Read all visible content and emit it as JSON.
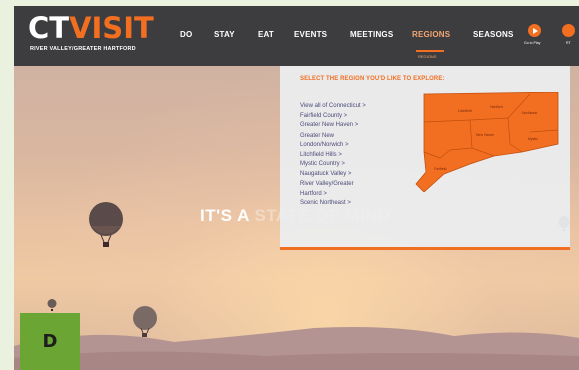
{
  "logo": {
    "part1": "CT",
    "part2": "VISIT",
    "subtitle": "RIVER VALLEY/GREATER HARTFORD"
  },
  "nav": {
    "items": [
      {
        "label": "DO"
      },
      {
        "label": "STAY"
      },
      {
        "label": "EAT"
      },
      {
        "label": "EVENTS"
      },
      {
        "label": "MEETINGS"
      },
      {
        "label": "REGIONS"
      },
      {
        "label": "SEASONS"
      }
    ],
    "active": "REGIONS",
    "sub_label": "REGIONS"
  },
  "tools": {
    "video_label": "Go to Play",
    "second_label": "RT"
  },
  "regions_dropdown": {
    "title": "SELECT THE REGION YOU'D LIKE TO EXPLORE:",
    "items": [
      {
        "label": "View all of Connecticut >"
      },
      {
        "label": "Fairfield County >"
      },
      {
        "label": "Greater New Haven >"
      },
      {
        "label": "Greater New London/Norwich >"
      },
      {
        "label": "Litchfield Hills >"
      },
      {
        "label": "Mystic Country >"
      },
      {
        "label": "Naugatuck Valley >"
      },
      {
        "label": "River Valley/Greater Hartford >"
      },
      {
        "label": "Scenic Northeast >"
      }
    ],
    "map_color": "#f26f21"
  },
  "hero": {
    "visible": "IT'S A ",
    "faded": "STATE OF MIND"
  },
  "badge": {
    "letter": "D"
  },
  "colors": {
    "accent": "#f26f21",
    "header_bg": "#3d3d3f",
    "badge_bg": "#6ba533",
    "link": "#4a4a78"
  }
}
